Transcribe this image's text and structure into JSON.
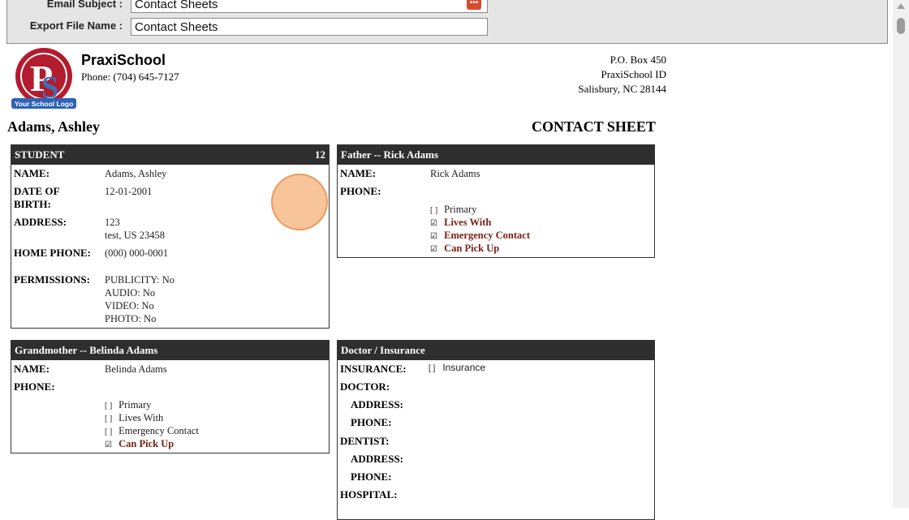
{
  "form": {
    "email_subject_label": "Email Subject :",
    "email_subject_value": "Contact Sheets",
    "export_label": "Export File Name :",
    "export_value": "Contact Sheets",
    "picker_icon": "calendar-icon"
  },
  "school": {
    "name": "PraxiSchool",
    "phone": "Phone: (704) 645-7127",
    "logo_caption": "Your School Logo",
    "address": [
      "P.O. Box 450",
      "PraxiSchool ID",
      "Salisbury, NC 28144"
    ]
  },
  "sheet": {
    "student_name": "Adams, Ashley",
    "title": "CONTACT SHEET"
  },
  "student_box": {
    "header": "STUDENT",
    "grade": "12",
    "name_label": "NAME:",
    "name": "Adams, Ashley",
    "dob_label_1": "DATE OF",
    "dob_label_2": "BIRTH:",
    "dob": "12-01-2001",
    "address_label": "ADDRESS:",
    "address_1": "123",
    "address_2": "test, US 23458",
    "home_phone_label": "HOME PHONE:",
    "home_phone": "(000) 000-0001",
    "permissions_label": "PERMISSIONS:",
    "permissions": [
      "PUBLICITY: No",
      "AUDIO: No",
      "VIDEO: No",
      "PHOTO: No"
    ]
  },
  "father_box": {
    "header": "Father -- Rick Adams",
    "name_label": "NAME:",
    "name": "Rick Adams",
    "phone_label": "PHONE:",
    "checks": [
      {
        "label": "Primary",
        "checked": false
      },
      {
        "label": "Lives With",
        "checked": true
      },
      {
        "label": "Emergency Contact",
        "checked": true
      },
      {
        "label": "Can Pick Up",
        "checked": true
      }
    ]
  },
  "grandmother_box": {
    "header": "Grandmother -- Belinda Adams",
    "name_label": "NAME:",
    "name": "Belinda Adams",
    "phone_label": "PHONE:",
    "checks": [
      {
        "label": "Primary",
        "checked": false
      },
      {
        "label": "Lives With",
        "checked": false
      },
      {
        "label": "Emergency Contact",
        "checked": false
      },
      {
        "label": "Can Pick Up",
        "checked": true
      }
    ]
  },
  "doctor_box": {
    "header": "Doctor / Insurance",
    "insurance_label": "INSURANCE:",
    "insurance_check": "Insurance",
    "doctor_label": "DOCTOR:",
    "address_label": "ADDRESS:",
    "phone_label": "PHONE:",
    "dentist_label": "DENTIST:",
    "dentist_address_label": "ADDRESS:",
    "dentist_phone_label": "PHONE:",
    "hospital_label": "HOSPITAL:"
  },
  "marks": {
    "checked": "☑",
    "unchecked": "[ ]"
  }
}
